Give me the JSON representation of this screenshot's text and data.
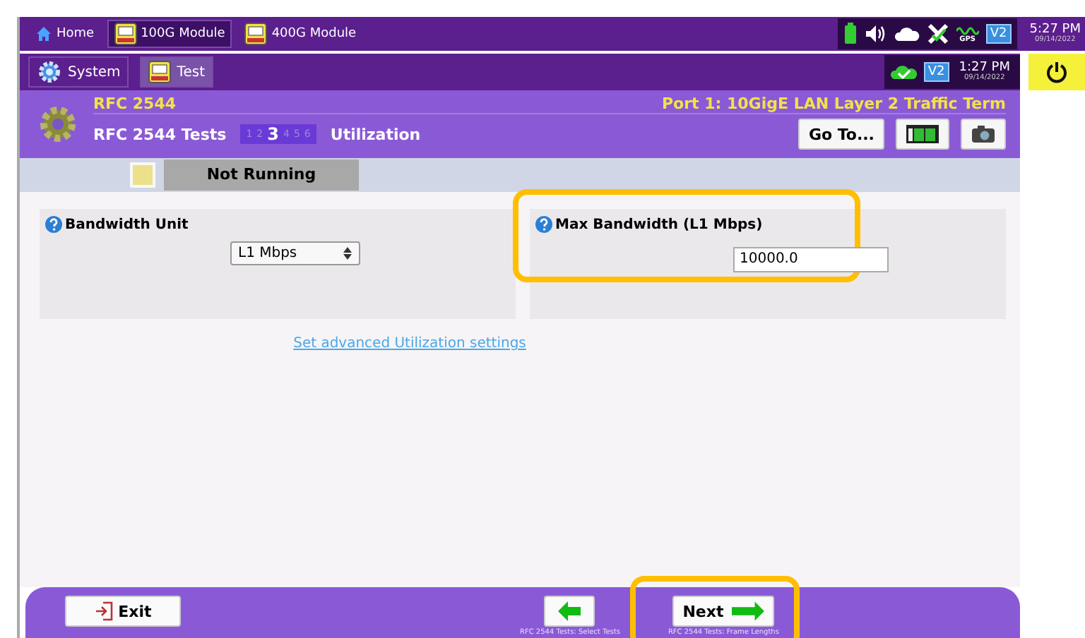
{
  "top_bar": {
    "tabs": [
      {
        "label": "Home",
        "selected": false,
        "kind": "home"
      },
      {
        "label": "100G Module",
        "selected": true,
        "kind": "module"
      },
      {
        "label": "400G Module",
        "selected": false,
        "kind": "module"
      }
    ],
    "status": {
      "gps_label": "GPS",
      "badge": "V2",
      "time": "5:27 PM",
      "date": "09/14/2022"
    }
  },
  "app_bar": {
    "tabs": [
      {
        "label": "System",
        "selected": false,
        "kind": "system"
      },
      {
        "label": "Test",
        "selected": true,
        "kind": "module"
      }
    ],
    "badge": "V2",
    "time": "1:27 PM",
    "date": "09/14/2022"
  },
  "header": {
    "title": "RFC 2544",
    "port": "Port 1: 10GigE LAN Layer 2 Traffic Term",
    "test": "RFC 2544 Tests",
    "steps": [
      {
        "label": "1",
        "selected": false
      },
      {
        "label": "2",
        "selected": false
      },
      {
        "label": "3",
        "selected": true
      },
      {
        "label": "4",
        "selected": false
      },
      {
        "label": "5",
        "selected": false
      },
      {
        "label": "6",
        "selected": false
      }
    ],
    "page": "Utilization",
    "goto": "Go To..."
  },
  "status": {
    "text": "Not Running"
  },
  "fields": [
    {
      "kind": "select",
      "label": "Bandwidth Unit",
      "value": "L1 Mbps",
      "highlighted": false
    },
    {
      "kind": "input",
      "label": "Max Bandwidth (L1 Mbps)",
      "value": "10000.0",
      "highlighted": true
    }
  ],
  "link": "Set advanced Utilization settings",
  "footer": {
    "exit": "Exit",
    "next": {
      "label": "Next",
      "highlighted": true
    },
    "back_hint": "RFC 2544 Tests: Select Tests",
    "next_hint": "RFC 2544 Tests: Frame Lengths"
  }
}
